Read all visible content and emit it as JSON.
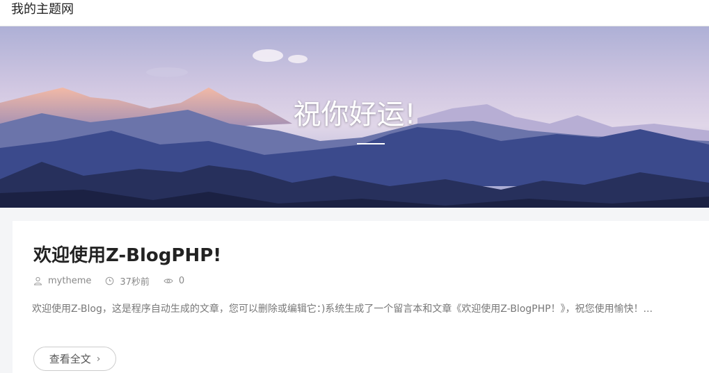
{
  "header": {
    "site_title": "我的主题网"
  },
  "banner": {
    "title": "祝你好运!"
  },
  "post": {
    "title": "欢迎使用Z-BlogPHP!",
    "author": "mytheme",
    "time": "37秒前",
    "views": "0",
    "excerpt": "欢迎使用Z-Blog，这是程序自动生成的文章，您可以删除或编辑它：)系统生成了一个留言本和文章《欢迎使用Z-BlogPHP！》，祝您使用愉快！...",
    "read_more": "查看全文"
  },
  "icons": {
    "author": "user-icon",
    "time": "clock-icon",
    "views": "eye-icon",
    "more": "chevron-right-icon"
  }
}
